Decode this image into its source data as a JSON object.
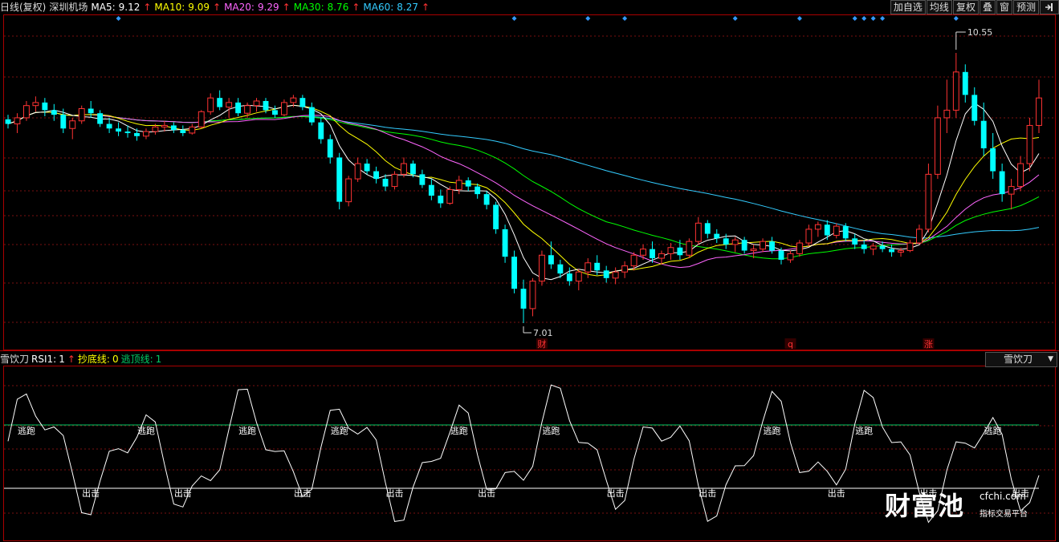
{
  "header": {
    "period_label": "日线(复权)",
    "stock_name": "深圳机场",
    "ma": [
      {
        "label": "MA5:",
        "value": "9.12",
        "color": "#ffffff"
      },
      {
        "label": "MA10:",
        "value": "9.09",
        "color": "#ffff00"
      },
      {
        "label": "MA20:",
        "value": "9.29",
        "color": "#ff66ff"
      },
      {
        "label": "MA30:",
        "value": "8.76",
        "color": "#00ff00"
      },
      {
        "label": "MA60:",
        "value": "8.27",
        "color": "#33ccff"
      }
    ],
    "up_arrow": "↑",
    "arrow_color": "#ff3333"
  },
  "toolbar": {
    "items": [
      "加自选",
      "均线",
      "复权",
      "叠",
      "窗",
      "预测"
    ],
    "pin_icon": "pin-right-icon"
  },
  "price_chart": {
    "high_label": "10.55",
    "low_label": "7.01",
    "event_markers": [
      {
        "text": "财",
        "color": "#ff3333"
      },
      {
        "text": "q",
        "color": "#ff3333"
      },
      {
        "text": "涨",
        "color": "#ff3333"
      }
    ],
    "colors": {
      "up": "#ff3333",
      "down": "#00ffff",
      "grid": "#7a1010",
      "border": "#aa0000",
      "diamond": "#3399ff"
    }
  },
  "indicator": {
    "name": "雪饮刀",
    "rsi_label": "RSI1:",
    "rsi_value": "1",
    "buy_label": "抄底线:",
    "buy_value": "0",
    "sell_label": "逃顶线:",
    "sell_value": "1",
    "buy_color": "#ffff00",
    "sell_color": "#00cc66",
    "escape_text": "逃跑",
    "attack_text": "出击",
    "selector_label": "雪饮刀"
  },
  "watermark": {
    "main": "财富池",
    "site": "cfchi.com",
    "sub": "指标交易平台"
  },
  "chart_data": {
    "type": "candlestick",
    "title": "",
    "price_range": [
      7.01,
      10.55
    ],
    "candles": [
      [
        9.68,
        9.74,
        9.56,
        9.62
      ],
      [
        9.62,
        9.76,
        9.5,
        9.7
      ],
      [
        9.7,
        9.92,
        9.66,
        9.86
      ],
      [
        9.86,
        9.98,
        9.78,
        9.9
      ],
      [
        9.9,
        9.96,
        9.72,
        9.8
      ],
      [
        9.8,
        9.88,
        9.66,
        9.74
      ],
      [
        9.74,
        9.82,
        9.5,
        9.56
      ],
      [
        9.56,
        9.7,
        9.42,
        9.66
      ],
      [
        9.66,
        9.86,
        9.62,
        9.82
      ],
      [
        9.82,
        9.92,
        9.7,
        9.76
      ],
      [
        9.76,
        9.8,
        9.58,
        9.62
      ],
      [
        9.62,
        9.7,
        9.5,
        9.56
      ],
      [
        9.56,
        9.64,
        9.46,
        9.52
      ],
      [
        9.52,
        9.6,
        9.44,
        9.5
      ],
      [
        9.5,
        9.56,
        9.4,
        9.46
      ],
      [
        9.46,
        9.56,
        9.42,
        9.52
      ],
      [
        9.52,
        9.62,
        9.48,
        9.58
      ],
      [
        9.58,
        9.66,
        9.52,
        9.6
      ],
      [
        9.6,
        9.64,
        9.5,
        9.54
      ],
      [
        9.54,
        9.6,
        9.46,
        9.5
      ],
      [
        9.5,
        9.62,
        9.48,
        9.58
      ],
      [
        9.58,
        9.8,
        9.56,
        9.78
      ],
      [
        9.78,
        10.02,
        9.74,
        9.96
      ],
      [
        9.96,
        10.06,
        9.8,
        9.84
      ],
      [
        9.84,
        9.96,
        9.7,
        9.9
      ],
      [
        9.9,
        9.96,
        9.72,
        9.76
      ],
      [
        9.76,
        9.9,
        9.7,
        9.86
      ],
      [
        9.86,
        9.96,
        9.78,
        9.92
      ],
      [
        9.92,
        9.96,
        9.76,
        9.8
      ],
      [
        9.8,
        9.86,
        9.7,
        9.74
      ],
      [
        9.74,
        9.94,
        9.72,
        9.9
      ],
      [
        9.9,
        10.0,
        9.84,
        9.96
      ],
      [
        9.96,
        10.0,
        9.8,
        9.84
      ],
      [
        9.84,
        9.9,
        9.6,
        9.64
      ],
      [
        9.64,
        9.7,
        9.36,
        9.42
      ],
      [
        9.42,
        9.48,
        9.1,
        9.18
      ],
      [
        9.18,
        9.24,
        8.5,
        8.6
      ],
      [
        8.6,
        8.94,
        8.54,
        8.9
      ],
      [
        8.9,
        9.18,
        8.86,
        9.1
      ],
      [
        9.1,
        9.16,
        8.96,
        9.0
      ],
      [
        9.0,
        9.06,
        8.84,
        8.9
      ],
      [
        8.9,
        8.96,
        8.74,
        8.8
      ],
      [
        8.8,
        9.0,
        8.76,
        8.96
      ],
      [
        8.96,
        9.18,
        8.92,
        9.1
      ],
      [
        9.1,
        9.14,
        8.92,
        8.96
      ],
      [
        8.96,
        9.02,
        8.78,
        8.82
      ],
      [
        8.82,
        8.9,
        8.62,
        8.68
      ],
      [
        8.68,
        8.76,
        8.52,
        8.58
      ],
      [
        8.58,
        8.8,
        8.56,
        8.76
      ],
      [
        8.76,
        8.94,
        8.7,
        8.88
      ],
      [
        8.88,
        8.92,
        8.74,
        8.8
      ],
      [
        8.8,
        8.84,
        8.64,
        8.7
      ],
      [
        8.7,
        8.74,
        8.5,
        8.56
      ],
      [
        8.56,
        8.6,
        8.18,
        8.24
      ],
      [
        8.24,
        8.3,
        7.8,
        7.88
      ],
      [
        7.88,
        7.96,
        7.4,
        7.46
      ],
      [
        7.46,
        7.58,
        7.01,
        7.2
      ],
      [
        7.2,
        7.6,
        7.1,
        7.56
      ],
      [
        7.56,
        7.96,
        7.5,
        7.9
      ],
      [
        7.9,
        8.08,
        7.72,
        7.78
      ],
      [
        7.78,
        7.84,
        7.6,
        7.66
      ],
      [
        7.66,
        7.74,
        7.5,
        7.56
      ],
      [
        7.56,
        7.72,
        7.44,
        7.68
      ],
      [
        7.68,
        7.86,
        7.6,
        7.8
      ],
      [
        7.8,
        7.9,
        7.64,
        7.7
      ],
      [
        7.7,
        7.76,
        7.54,
        7.6
      ],
      [
        7.6,
        7.74,
        7.52,
        7.68
      ],
      [
        7.68,
        7.82,
        7.6,
        7.76
      ],
      [
        7.76,
        7.94,
        7.7,
        7.9
      ],
      [
        7.9,
        8.04,
        7.84,
        7.98
      ],
      [
        7.98,
        8.08,
        7.8,
        7.86
      ],
      [
        7.86,
        7.96,
        7.78,
        7.92
      ],
      [
        7.92,
        8.06,
        7.84,
        8.0
      ],
      [
        8.0,
        8.1,
        7.84,
        7.9
      ],
      [
        7.9,
        8.12,
        7.86,
        8.08
      ],
      [
        8.08,
        8.4,
        8.04,
        8.32
      ],
      [
        8.32,
        8.36,
        8.12,
        8.18
      ],
      [
        8.18,
        8.24,
        8.06,
        8.12
      ],
      [
        8.12,
        8.18,
        7.98,
        8.04
      ],
      [
        8.04,
        8.14,
        7.94,
        8.1
      ],
      [
        8.1,
        8.14,
        7.92,
        7.96
      ],
      [
        7.96,
        8.04,
        7.86,
        7.98
      ],
      [
        7.98,
        8.12,
        7.94,
        8.08
      ],
      [
        8.08,
        8.14,
        7.92,
        7.96
      ],
      [
        7.96,
        8.0,
        7.78,
        7.84
      ],
      [
        7.84,
        7.96,
        7.8,
        7.92
      ],
      [
        7.92,
        8.1,
        7.88,
        8.06
      ],
      [
        8.06,
        8.3,
        8.02,
        8.24
      ],
      [
        8.24,
        8.34,
        8.14,
        8.3
      ],
      [
        8.3,
        8.36,
        8.1,
        8.16
      ],
      [
        8.16,
        8.32,
        8.12,
        8.28
      ],
      [
        8.28,
        8.32,
        8.08,
        8.12
      ],
      [
        8.12,
        8.18,
        7.98,
        8.04
      ],
      [
        8.04,
        8.1,
        7.92,
        7.98
      ],
      [
        7.98,
        8.06,
        7.9,
        8.02
      ],
      [
        8.02,
        8.08,
        7.94,
        7.98
      ],
      [
        7.98,
        8.04,
        7.88,
        7.94
      ],
      [
        7.94,
        8.0,
        7.88,
        7.96
      ],
      [
        7.96,
        8.1,
        7.94,
        8.06
      ],
      [
        8.06,
        8.3,
        8.04,
        8.24
      ],
      [
        8.24,
        9.1,
        8.2,
        8.96
      ],
      [
        8.96,
        9.86,
        8.9,
        9.7
      ],
      [
        9.7,
        10.2,
        9.5,
        9.8
      ],
      [
        9.8,
        10.55,
        9.7,
        10.3
      ],
      [
        10.3,
        10.4,
        9.9,
        10.0
      ],
      [
        10.0,
        10.1,
        9.6,
        9.66
      ],
      [
        9.66,
        9.9,
        9.2,
        9.3
      ],
      [
        9.3,
        9.5,
        8.9,
        9.0
      ],
      [
        9.0,
        9.1,
        8.6,
        8.7
      ],
      [
        8.7,
        8.9,
        8.5,
        8.8
      ],
      [
        8.8,
        9.2,
        8.74,
        9.1
      ],
      [
        9.1,
        9.7,
        9.0,
        9.6
      ],
      [
        9.6,
        10.2,
        9.5,
        9.96
      ]
    ],
    "rsi_levels": {
      "upper": 1,
      "lower": 0
    }
  }
}
